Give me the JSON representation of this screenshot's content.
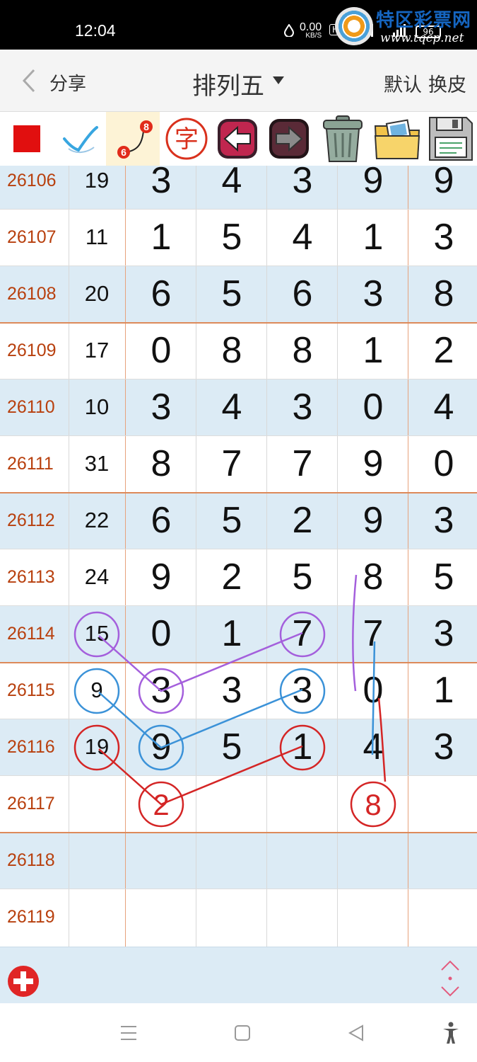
{
  "status": {
    "time": "12:04",
    "speed": "0.00",
    "speed_unit": "KB/S",
    "hd": "HD",
    "net_4g": "4G",
    "net_5g": "5G",
    "battery": "96"
  },
  "watermark": {
    "brand": "特区彩票网",
    "url": "www.tqcp.net"
  },
  "header": {
    "share_label": "分享",
    "title": "排列五",
    "default_label": "默认",
    "skin_label": "换皮"
  },
  "toolbar": {
    "tools": [
      {
        "icon": "red-square-icon"
      },
      {
        "icon": "checkmark-icon"
      },
      {
        "icon": "connect-numbers-icon",
        "num_top": "8",
        "num_bottom": "6"
      },
      {
        "icon": "character-icon",
        "char": "字"
      },
      {
        "icon": "undo-arrow-icon"
      },
      {
        "icon": "redo-arrow-icon"
      },
      {
        "icon": "trash-icon"
      },
      {
        "icon": "image-folder-icon"
      },
      {
        "icon": "floppy-save-icon"
      }
    ]
  },
  "colors": {
    "issue_text": "#b8400e",
    "row_blue": "#dcebf5",
    "divider_orange": "#dd8a5a",
    "mark_purple": "#9b59d6",
    "mark_blue": "#3b8fd8",
    "mark_red": "#d42020"
  },
  "table": {
    "rows": [
      {
        "issue": "26106",
        "sum": "19",
        "digits": [
          "3",
          "4",
          "3",
          "9",
          "9"
        ]
      },
      {
        "issue": "26107",
        "sum": "11",
        "digits": [
          "1",
          "5",
          "4",
          "1",
          "3"
        ]
      },
      {
        "issue": "26108",
        "sum": "20",
        "digits": [
          "6",
          "5",
          "6",
          "3",
          "8"
        ]
      },
      {
        "issue": "26109",
        "sum": "17",
        "digits": [
          "0",
          "8",
          "8",
          "1",
          "2"
        ]
      },
      {
        "issue": "26110",
        "sum": "10",
        "digits": [
          "3",
          "4",
          "3",
          "0",
          "4"
        ]
      },
      {
        "issue": "26111",
        "sum": "31",
        "digits": [
          "8",
          "7",
          "7",
          "9",
          "0"
        ]
      },
      {
        "issue": "26112",
        "sum": "22",
        "digits": [
          "6",
          "5",
          "2",
          "9",
          "3"
        ]
      },
      {
        "issue": "26113",
        "sum": "24",
        "digits": [
          "9",
          "2",
          "5",
          "8",
          "5"
        ]
      },
      {
        "issue": "26114",
        "sum": "15",
        "digits": [
          "0",
          "1",
          "7",
          "7",
          "3"
        ]
      },
      {
        "issue": "26115",
        "sum": "9",
        "digits": [
          "3",
          "3",
          "3",
          "0",
          "1"
        ]
      },
      {
        "issue": "26116",
        "sum": "19",
        "digits": [
          "9",
          "5",
          "1",
          "4",
          "3"
        ]
      },
      {
        "issue": "26117",
        "sum": "",
        "digits": [
          "",
          "",
          "",
          "",
          ""
        ]
      },
      {
        "issue": "26118",
        "sum": "",
        "digits": [
          "",
          "",
          "",
          "",
          ""
        ]
      },
      {
        "issue": "26119",
        "sum": "",
        "digits": [
          "",
          "",
          "",
          "",
          ""
        ]
      }
    ]
  },
  "annotations": {
    "predictions": [
      {
        "issue": "26117",
        "column": 1,
        "value": "2"
      },
      {
        "issue": "26117",
        "column": 4,
        "value": "8"
      }
    ]
  },
  "bottom": {
    "add_icon": "plus-circle-icon",
    "scroll_icon": "expand-arrows-icon"
  },
  "navbar": {
    "items": [
      "menu-icon",
      "home-icon",
      "back-triangle-icon",
      "accessibility-icon"
    ]
  }
}
